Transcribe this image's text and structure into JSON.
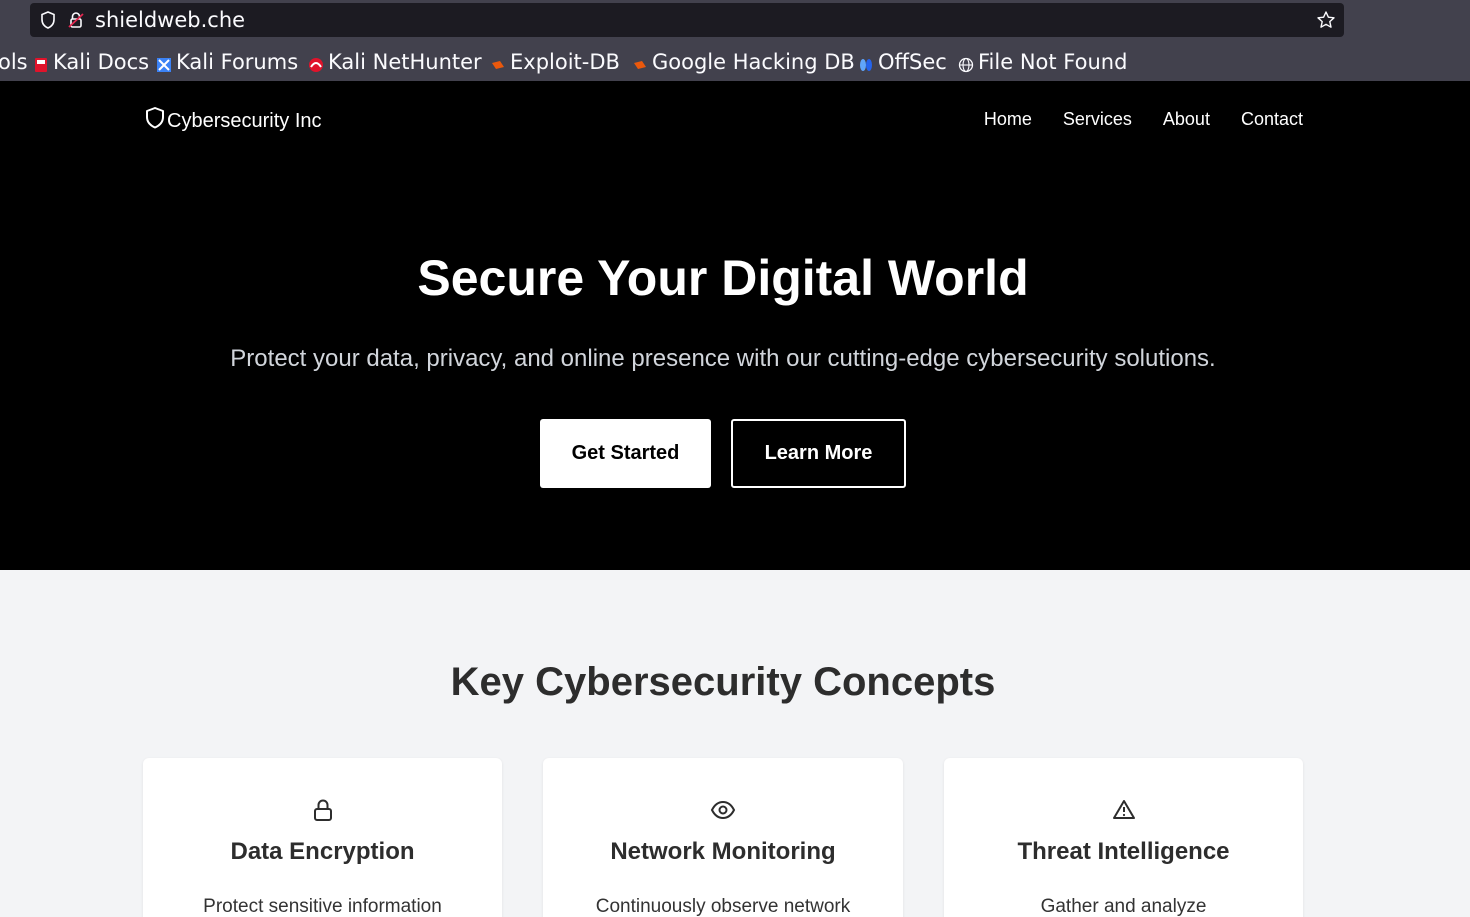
{
  "browser": {
    "url": "shieldweb.che",
    "bookmarks": [
      {
        "label": "ols",
        "icon": "none"
      },
      {
        "label": "Kali Docs",
        "icon": "kali-docs-icon"
      },
      {
        "label": "Kali Forums",
        "icon": "kali-forums-icon"
      },
      {
        "label": "Kali NetHunter",
        "icon": "kali-nethunter-icon"
      },
      {
        "label": "Exploit-DB",
        "icon": "exploit-db-icon"
      },
      {
        "label": "Google Hacking DB",
        "icon": "ghdb-icon"
      },
      {
        "label": "OffSec",
        "icon": "offsec-icon"
      },
      {
        "label": "File Not Found",
        "icon": "globe-icon"
      }
    ]
  },
  "nav": {
    "brand": "Cybersecurity Inc",
    "links": [
      "Home",
      "Services",
      "About",
      "Contact"
    ]
  },
  "hero": {
    "title": "Secure Your Digital World",
    "subtitle": "Protect your data, privacy, and online presence with our cutting-edge cybersecurity solutions.",
    "primary_button": "Get Started",
    "secondary_button": "Learn More"
  },
  "concepts": {
    "title": "Key Cybersecurity Concepts",
    "cards": [
      {
        "icon": "lock-icon",
        "title": "Data Encryption",
        "desc": "Protect sensitive information"
      },
      {
        "icon": "eye-icon",
        "title": "Network Monitoring",
        "desc": "Continuously observe network"
      },
      {
        "icon": "alert-triangle-icon",
        "title": "Threat Intelligence",
        "desc": "Gather and analyze"
      }
    ]
  },
  "colors": {
    "hero_bg": "#000000",
    "page_bg": "#f3f4f6",
    "chrome_bg": "#42414d",
    "urlbar_bg": "#1c1b22"
  }
}
